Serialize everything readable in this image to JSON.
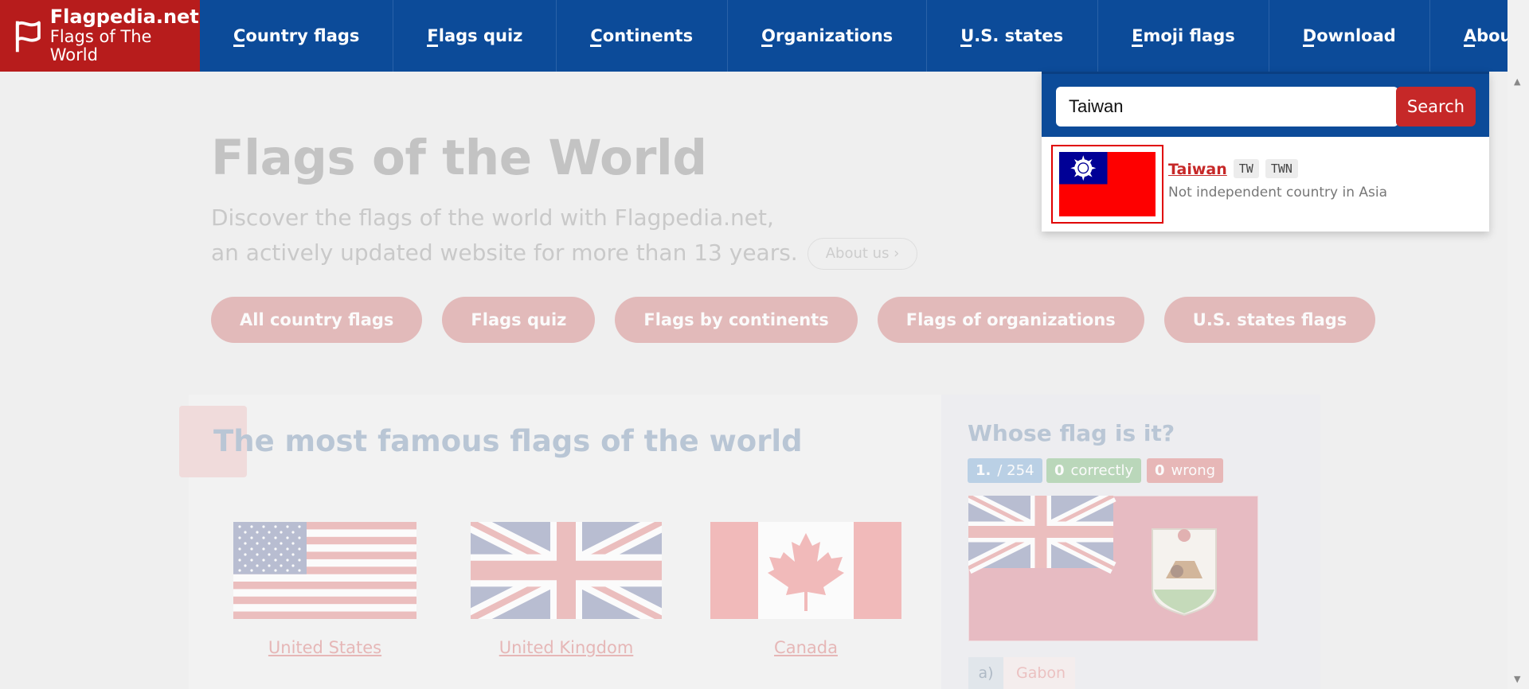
{
  "logo": {
    "name": "Flagpedia.net",
    "subtitle": "Flags of The World"
  },
  "nav": {
    "items": [
      {
        "label": "Country flags"
      },
      {
        "label": "Flags quiz"
      },
      {
        "label": "Continents"
      },
      {
        "label": "Organizations"
      },
      {
        "label": "U.S. states"
      },
      {
        "label": "Emoji flags"
      },
      {
        "label": "Download"
      },
      {
        "label": "About"
      }
    ],
    "close_icon": "close-icon"
  },
  "search": {
    "value": "Taiwan",
    "button_label": "Search",
    "results": [
      {
        "name": "Taiwan",
        "code2": "TW",
        "code3": "TWN",
        "description": "Not independent country in Asia",
        "flag_icon": "taiwan-flag"
      }
    ]
  },
  "hero": {
    "title": "Flags of the World",
    "subtitle_line1": "Discover the flags of the world with Flagpedia.net,",
    "subtitle_line2": "an actively updated website for more than 13 years.",
    "about_button": "About us ›"
  },
  "pills": [
    {
      "label": "All country flags"
    },
    {
      "label": "Flags quiz"
    },
    {
      "label": "Flags by continents"
    },
    {
      "label": "Flags of organizations"
    },
    {
      "label": "U.S. states flags"
    }
  ],
  "famous": {
    "title": "The most famous flags of the world",
    "flags": [
      {
        "name": "United States",
        "flag_icon": "us-flag"
      },
      {
        "name": "United Kingdom",
        "flag_icon": "uk-flag"
      },
      {
        "name": "Canada",
        "flag_icon": "canada-flag"
      }
    ]
  },
  "quiz": {
    "title": "Whose flag is it?",
    "question_number": "1.",
    "question_total": "/ 254",
    "correct_count": "0",
    "correct_label": "correctly",
    "wrong_count": "0",
    "wrong_label": "wrong",
    "flag_icon": "bermuda-flag",
    "answers": [
      {
        "letter": "a)",
        "text": "Gabon"
      }
    ]
  },
  "colors": {
    "nav_bg": "#0c4b99",
    "logo_bg": "#b71c1c",
    "accent_red": "#c62828",
    "pill_bg": "#dea9a9"
  }
}
